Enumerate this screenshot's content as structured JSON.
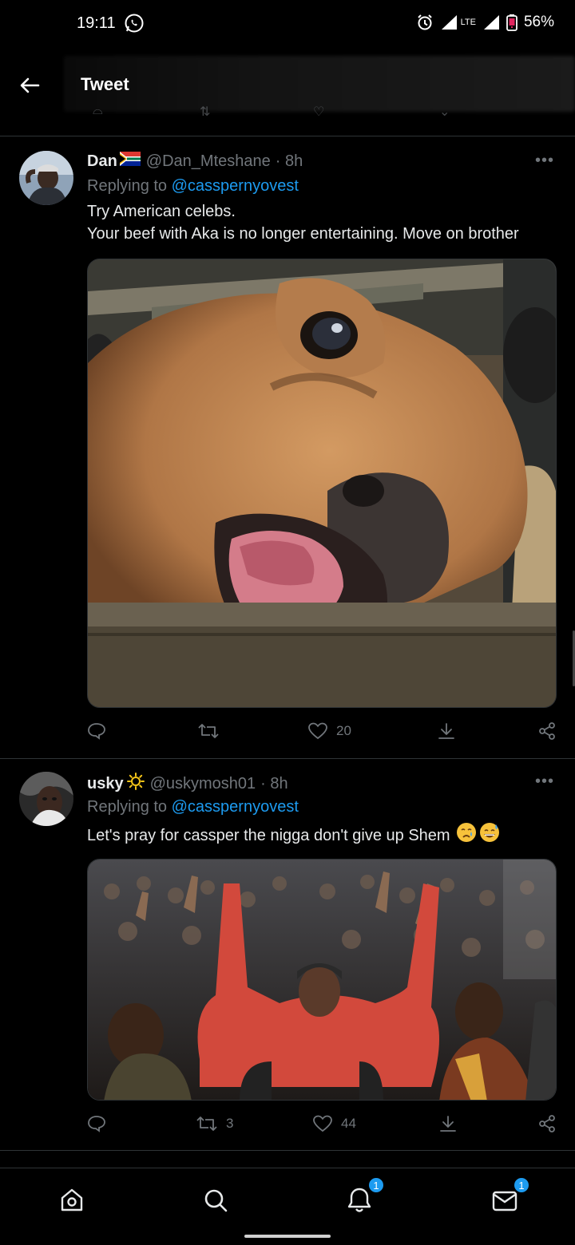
{
  "status_bar": {
    "time": "19:11",
    "network": "LTE",
    "battery": "56%",
    "icons": [
      "whatsapp-icon",
      "alarm-icon",
      "signal-icon",
      "battery-icon"
    ]
  },
  "header": {
    "title": "Tweet",
    "back_icon": "arrow-left-icon"
  },
  "tweets": [
    {
      "name": "Dan",
      "flag": "south-africa-flag-icon",
      "handle": "@Dan_Mteshane",
      "time": "· 8h",
      "replying_prefix": "Replying to",
      "replying_to": "@casspernyovest",
      "lines": [
        "Try American celebs.",
        "Your beef with Aka is no longer entertaining. Move on brother"
      ],
      "media": "photo of a surprised cow with open mouth over a fence",
      "likes": "20",
      "retweets": ""
    },
    {
      "name": "usky",
      "flag": "sun-icon",
      "handle": "@uskymosh01",
      "time": "· 8h",
      "replying_prefix": "Replying to",
      "replying_to": "@casspernyovest",
      "lines": [
        "Let's pray for cassper the nigga don't give up Shem"
      ],
      "emoji": [
        "crying-face-icon",
        "grinning-sweat-icon"
      ],
      "media": "photo of a crowd with raised hands",
      "likes": "44",
      "retweets": "3"
    }
  ],
  "bottom_nav": {
    "items": [
      "home-icon",
      "search-icon",
      "notifications-icon",
      "messages-icon"
    ],
    "notifications_badge": "1",
    "messages_badge": "1"
  },
  "colors": {
    "background": "#000000",
    "accent": "#1d9bf0",
    "muted": "#71767b",
    "text": "#e7e9ea"
  }
}
